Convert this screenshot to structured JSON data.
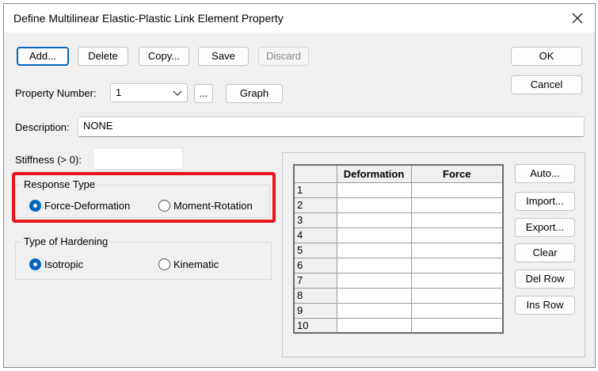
{
  "window": {
    "title": "Define Multilinear Elastic-Plastic Link Element Property"
  },
  "buttons": {
    "add": "Add...",
    "delete": "Delete",
    "copy": "Copy...",
    "save": "Save",
    "discard": "Discard",
    "ok": "OK",
    "cancel": "Cancel",
    "ellipsis": "...",
    "graph": "Graph"
  },
  "property": {
    "label": "Property Number:",
    "value": "1"
  },
  "description": {
    "label": "Description:",
    "value": "NONE"
  },
  "stiffness": {
    "label": "Stiffness (> 0):",
    "value": ""
  },
  "response_type": {
    "legend": "Response Type",
    "options": [
      "Force-Deformation",
      "Moment-Rotation"
    ],
    "selected": "Force-Deformation"
  },
  "hardening": {
    "legend": "Type of Hardening",
    "options": [
      "Isotropic",
      "Kinematic"
    ],
    "selected": "Isotropic"
  },
  "table": {
    "headers": [
      "Deformation",
      "Force"
    ],
    "rows": [
      "1",
      "2",
      "3",
      "4",
      "5",
      "6",
      "7",
      "8",
      "9",
      "10"
    ]
  },
  "side_buttons": [
    "Auto...",
    "Import...",
    "Export...",
    "Clear",
    "Del Row",
    "Ins Row"
  ],
  "colors": {
    "accent": "#0067c0",
    "highlight": "#e8141c"
  }
}
